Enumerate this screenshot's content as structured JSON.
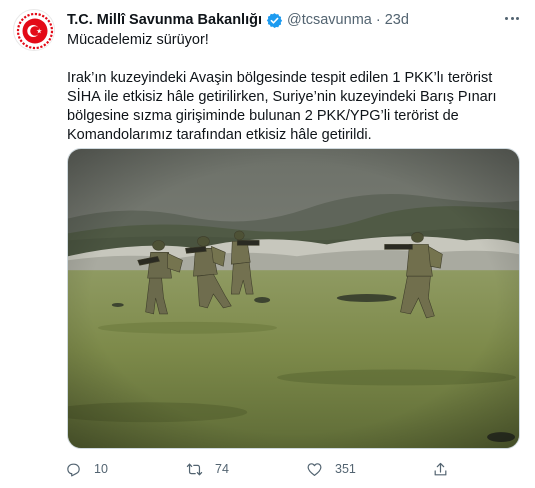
{
  "tweet": {
    "author_name": "T.C. Millî Savunma Bakanlığı",
    "handle": "@tcsavunma",
    "separator": "·",
    "time": "23d",
    "headline": "Mücadelemiz sürüyor!",
    "body": "Irak’ın kuzeyindeki Avaşin bölgesinde tespit edilen 1 PKK’lı terörist SİHA ile etkisiz hâle getirilirken, Suriye’nin kuzeyindeki Barış Pınarı bölgesine sızma girişiminde bulunan 2 PKK/YPG’li terörist de Komandolarımız tarafından etkisiz hâle getirildi."
  },
  "icons": {
    "avatar": "ministry-emblem",
    "verified": "verified-badge-icon",
    "more": "more-options-icon",
    "reply": "reply-icon",
    "retweet": "retweet-icon",
    "like": "heart-icon",
    "share": "share-icon"
  },
  "actions": {
    "reply_count": "10",
    "retweet_count": "74",
    "like_count": "351"
  },
  "colors": {
    "verified_blue": "#1d9bf0",
    "emblem_red": "#e30a17",
    "text_secondary": "#536471"
  }
}
